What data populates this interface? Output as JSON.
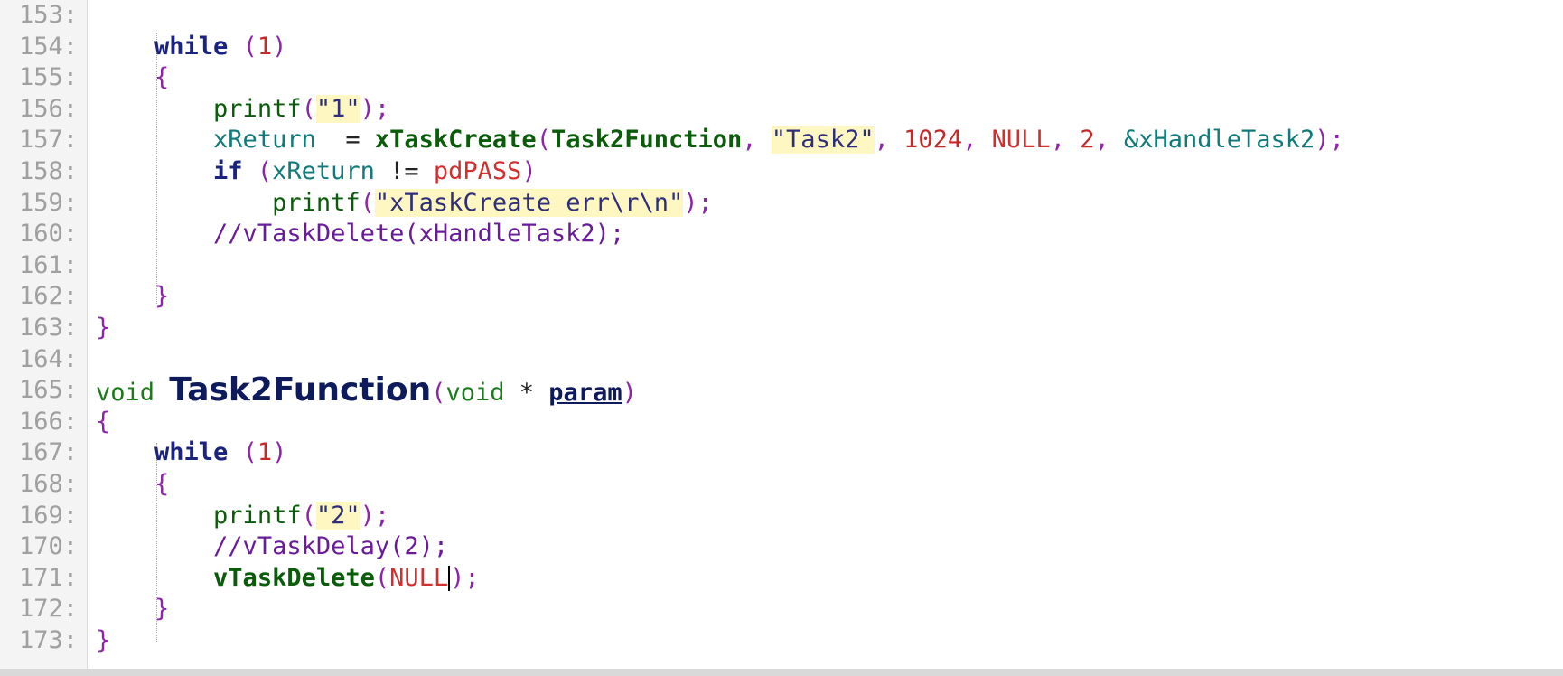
{
  "editor": {
    "lines": [
      {
        "n": "153:",
        "tokens": []
      },
      {
        "n": "154:",
        "tokens": [
          [
            "",
            "    "
          ],
          [
            "kw",
            "while"
          ],
          [
            "pn",
            " ("
          ],
          [
            "num",
            "1"
          ],
          [
            "pn",
            ")"
          ]
        ]
      },
      {
        "n": "155:",
        "tokens": [
          [
            "",
            "    "
          ],
          [
            "pn",
            "{"
          ]
        ]
      },
      {
        "n": "156:",
        "tokens": [
          [
            "",
            "        "
          ],
          [
            "fn2",
            "printf"
          ],
          [
            "pn",
            "("
          ],
          [
            "str",
            "\"1\""
          ],
          [
            "pn",
            ");"
          ]
        ]
      },
      {
        "n": "157:",
        "tokens": [
          [
            "",
            "        "
          ],
          [
            "id",
            "xReturn"
          ],
          [
            "",
            "  = "
          ],
          [
            "fn",
            "xTaskCreate"
          ],
          [
            "pn",
            "("
          ],
          [
            "fn",
            "Task2Function"
          ],
          [
            "pn",
            ", "
          ],
          [
            "str",
            "\"Task2\""
          ],
          [
            "pn",
            ", "
          ],
          [
            "num",
            "1024"
          ],
          [
            "pn",
            ", "
          ],
          [
            "cst",
            "NULL"
          ],
          [
            "pn",
            ", "
          ],
          [
            "num",
            "2"
          ],
          [
            "pn",
            ", "
          ],
          [
            "id",
            "&xHandleTask2"
          ],
          [
            "pn",
            ");"
          ]
        ]
      },
      {
        "n": "158:",
        "tokens": [
          [
            "",
            "        "
          ],
          [
            "kw",
            "if"
          ],
          [
            "pn",
            " ("
          ],
          [
            "id",
            "xReturn"
          ],
          [
            "",
            " != "
          ],
          [
            "cst",
            "pdPASS"
          ],
          [
            "pn",
            ")"
          ]
        ]
      },
      {
        "n": "159:",
        "tokens": [
          [
            "",
            "            "
          ],
          [
            "fn2",
            "printf"
          ],
          [
            "pn",
            "("
          ],
          [
            "str",
            "\"xTaskCreate err\\r\\n\""
          ],
          [
            "pn",
            ");"
          ]
        ]
      },
      {
        "n": "160:",
        "tokens": [
          [
            "",
            "        "
          ],
          [
            "cm",
            "//vTaskDelete(xHandleTask2);"
          ]
        ]
      },
      {
        "n": "161:",
        "tokens": []
      },
      {
        "n": "162:",
        "tokens": [
          [
            "",
            "    "
          ],
          [
            "pn",
            "}"
          ]
        ]
      },
      {
        "n": "163:",
        "tokens": [
          [
            "pn",
            "}"
          ]
        ]
      },
      {
        "n": "164:",
        "tokens": []
      },
      {
        "n": "165:",
        "tokens": [
          [
            "ty",
            "void "
          ],
          [
            "big",
            "Task2Function"
          ],
          [
            "pn",
            "("
          ],
          [
            "ty",
            "void"
          ],
          [
            "",
            " * "
          ],
          [
            "param",
            "param"
          ],
          [
            "pn",
            ")"
          ]
        ]
      },
      {
        "n": "166:",
        "tokens": [
          [
            "pn",
            "{"
          ]
        ]
      },
      {
        "n": "167:",
        "tokens": [
          [
            "",
            "    "
          ],
          [
            "kw",
            "while"
          ],
          [
            "pn",
            " ("
          ],
          [
            "num",
            "1"
          ],
          [
            "pn",
            ")"
          ]
        ]
      },
      {
        "n": "168:",
        "tokens": [
          [
            "",
            "    "
          ],
          [
            "pn",
            "{"
          ]
        ]
      },
      {
        "n": "169:",
        "tokens": [
          [
            "",
            "        "
          ],
          [
            "fn2",
            "printf"
          ],
          [
            "pn",
            "("
          ],
          [
            "str",
            "\"2\""
          ],
          [
            "pn",
            ");"
          ]
        ]
      },
      {
        "n": "170:",
        "tokens": [
          [
            "",
            "        "
          ],
          [
            "cm",
            "//vTaskDelay(2);"
          ]
        ]
      },
      {
        "n": "171:",
        "tokens": [
          [
            "",
            "        "
          ],
          [
            "fn",
            "vTaskDelete"
          ],
          [
            "pn",
            "("
          ],
          [
            "cst",
            "NULL"
          ],
          [
            "caret",
            ""
          ],
          [
            "pn",
            ");"
          ]
        ]
      },
      {
        "n": "172:",
        "tokens": [
          [
            "",
            "    "
          ],
          [
            "pn",
            "}"
          ]
        ]
      },
      {
        "n": "173:",
        "tokens": [
          [
            "pn",
            "}"
          ]
        ]
      }
    ]
  }
}
